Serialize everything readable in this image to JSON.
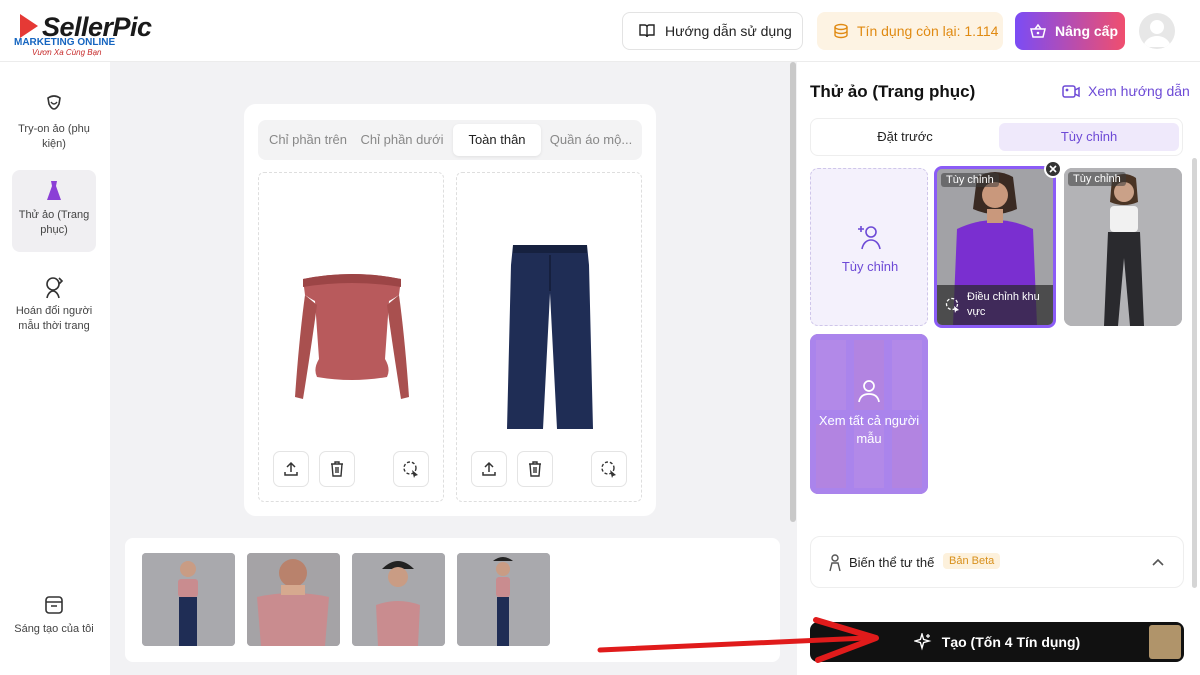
{
  "brand": {
    "name": "SellerPic",
    "tagline": "MARKETING ONLINE",
    "slogan": "Vươn Xa Cùng Bạn"
  },
  "header": {
    "guide_label": "Hướng dẫn sử dụng",
    "credits_label": "Tín dụng còn lại: 1.114",
    "upgrade_label": "Nâng cấp"
  },
  "nav": [
    {
      "label": "Try-on ảo (phụ kiện)",
      "icon": "accessory-tryon-icon"
    },
    {
      "label": "Thử ảo (Trang phục)",
      "icon": "dress-icon"
    },
    {
      "label": "Hoán đổi người mẫu thời trang",
      "icon": "model-swap-icon"
    },
    {
      "label": "Sáng tạo của tôi",
      "icon": "my-creations-icon"
    }
  ],
  "tabs": [
    "Chỉ phần trên",
    "Chỉ phần dưới",
    "Toàn thân",
    "Quần áo mộ..."
  ],
  "active_tab": "Toàn thân",
  "panel": {
    "title": "Thử ảo (Trang phục)",
    "guide_link": "Xem hướng dẫn",
    "segments": [
      "Đặt trước",
      "Tùy chỉnh"
    ],
    "custom_tile_label": "Tùy chỉnh",
    "model_tag": "Tùy chỉnh",
    "adjust_label": "Điều chỉnh khu vực",
    "view_all_label": "Xem tất cả người mẫu",
    "pose_label": "Biến thể tư thế",
    "beta_label": "Bản Beta",
    "create_label": "Tạo (Tốn 4 Tín dụng)"
  },
  "colors": {
    "accent": "#7b4cf5",
    "garment_top": "#b85a5c",
    "jeans": "#1f2d55",
    "arrow": "#e01b1b"
  }
}
